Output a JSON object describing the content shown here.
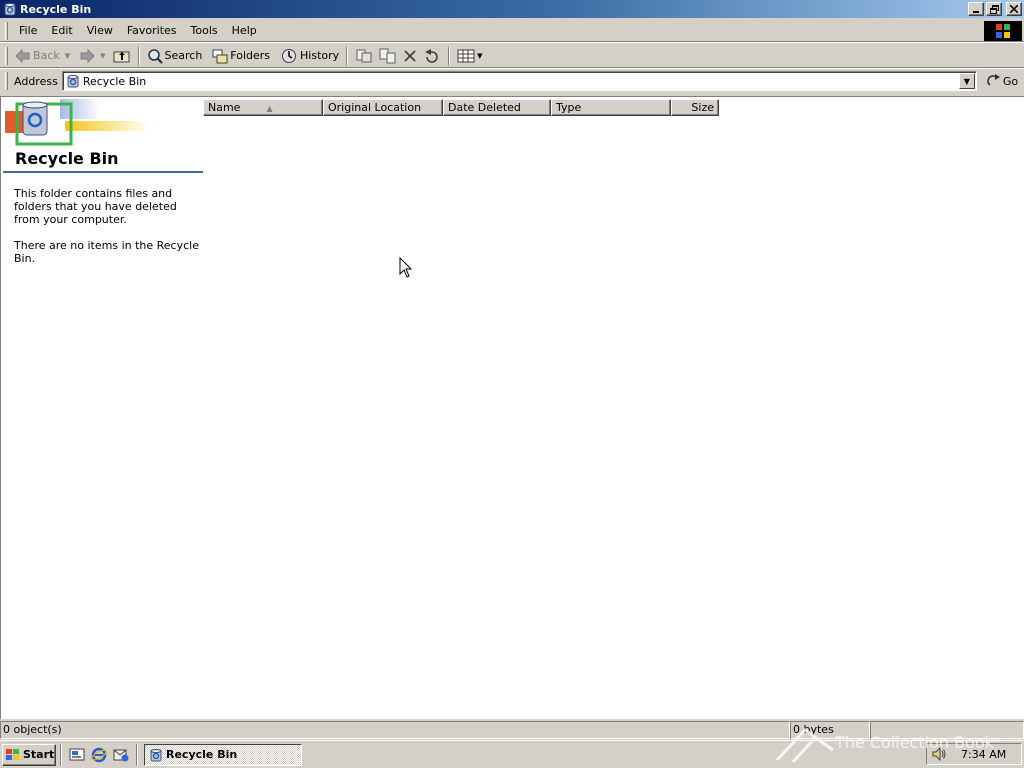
{
  "window": {
    "title": "Recycle Bin"
  },
  "menubar": {
    "items": [
      "File",
      "Edit",
      "View",
      "Favorites",
      "Tools",
      "Help"
    ]
  },
  "toolbar": {
    "back_label": "Back",
    "search_label": "Search",
    "folders_label": "Folders",
    "history_label": "History"
  },
  "address": {
    "label": "Address",
    "value": "Recycle Bin",
    "go_label": "Go"
  },
  "left_pane": {
    "title": "Recycle Bin",
    "description": "This folder contains files and folders that you have deleted from your computer.",
    "empty_message": "There are no items in the Recycle Bin."
  },
  "list": {
    "columns": [
      "Name",
      "Original Location",
      "Date Deleted",
      "Type",
      "Size"
    ],
    "sorted_column": "Name",
    "rows": []
  },
  "statusbar": {
    "objects": "0 object(s)",
    "size": "0 bytes"
  },
  "taskbar": {
    "start_label": "Start",
    "task_label": "Recycle Bin",
    "clock": "7:34 AM"
  },
  "watermark": "The Collection Book",
  "colors": {
    "title_gradient_start": "#0a246a",
    "title_gradient_end": "#a6caf0",
    "face": "#d4d0c8",
    "accent_rule": "#3a6ea5"
  }
}
